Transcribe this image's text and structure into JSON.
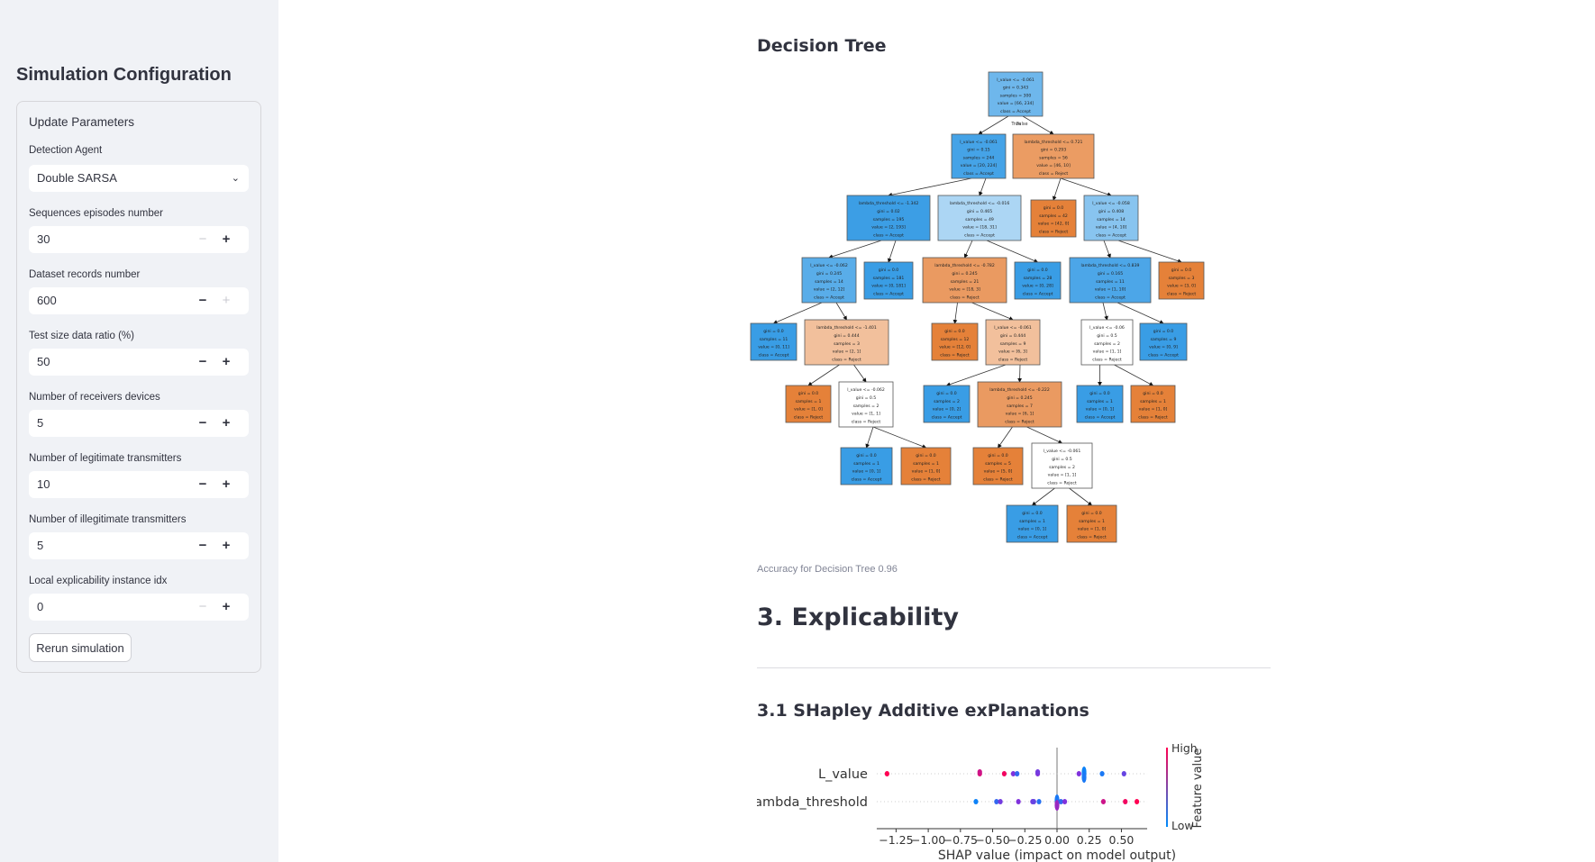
{
  "sidebar": {
    "title": "Simulation Configuration",
    "panel_title": "Update Parameters",
    "detection_agent": {
      "label": "Detection Agent",
      "value": "Double SARSA"
    },
    "fields": [
      {
        "label": "Sequences episodes number",
        "value": "30",
        "minus_enabled": false,
        "plus_enabled": true
      },
      {
        "label": "Dataset records number",
        "value": "600",
        "minus_enabled": true,
        "plus_enabled": false
      },
      {
        "label": "Test size data ratio (%)",
        "value": "50",
        "minus_enabled": true,
        "plus_enabled": true
      },
      {
        "label": "Number of receivers devices",
        "value": "5",
        "minus_enabled": true,
        "plus_enabled": true
      },
      {
        "label": "Number of legitimate transmitters",
        "value": "10",
        "minus_enabled": true,
        "plus_enabled": true
      },
      {
        "label": "Number of illegitimate transmitters",
        "value": "5",
        "minus_enabled": true,
        "plus_enabled": true
      },
      {
        "label": "Local explicability instance idx",
        "value": "0",
        "minus_enabled": false,
        "plus_enabled": true
      }
    ],
    "minus_symbol": "−",
    "plus_symbol": "+",
    "rerun_label": "Rerun simulation"
  },
  "main": {
    "tree_heading": "Decision Tree",
    "accuracy_caption": "Accuracy for Decision Tree 0.96",
    "section_heading": "3. Explicability",
    "shap_heading": "3.1 SHapley Additive exPlanations"
  },
  "tree": {
    "edge_labels": {
      "true": "True",
      "false": "False"
    },
    "colors": {
      "accept": "#399de5",
      "reject": "#e58139"
    },
    "nodes": {
      "root": [
        "l_value <= -0.061",
        "gini = 0.343",
        "samples = 300",
        "value = [66, 234]",
        "class = Accept"
      ],
      "n1": [
        "l_value <= -0.061",
        "gini = 0.15",
        "samples = 244",
        "value = [20, 224]",
        "class = Accept"
      ],
      "n2": [
        "lambda_threshold <= 0.721",
        "gini = 0.293",
        "samples = 56",
        "value = [46, 10]",
        "class = Reject"
      ],
      "A": [
        "lambda_threshold <= -1.342",
        "gini = 0.02",
        "samples = 195",
        "value = [2, 193]",
        "class = Accept"
      ],
      "B": [
        "lambda_threshold <= -0.016",
        "gini = 0.465",
        "samples = 49",
        "value = [18, 31]",
        "class = Accept"
      ],
      "C": [
        "gini = 0.0",
        "samples = 42",
        "value = [42, 0]",
        "class = Reject"
      ],
      "D": [
        "l_value <= -0.058",
        "gini = 0.408",
        "samples = 14",
        "value = [4, 10]",
        "class = Accept"
      ],
      "a": [
        "l_value <= -0.062",
        "gini = 0.245",
        "samples = 14",
        "value = [2, 12]",
        "class = Accept"
      ],
      "b": [
        "gini = 0.0",
        "samples = 181",
        "value = [0, 181]",
        "class = Accept"
      ],
      "c": [
        "lambda_threshold <= -0.782",
        "gini = 0.245",
        "samples = 21",
        "value = [18, 3]",
        "class = Reject"
      ],
      "d": [
        "gini = 0.0",
        "samples = 28",
        "value = [0, 28]",
        "class = Accept"
      ],
      "e": [
        "lambda_threshold <= 0.839",
        "gini = 0.165",
        "samples = 11",
        "value = [1, 10]",
        "class = Accept"
      ],
      "f": [
        "gini = 0.0",
        "samples = 3",
        "value = [3, 0]",
        "class = Reject"
      ],
      "g": [
        "gini = 0.0",
        "samples = 11",
        "value = [0, 11]",
        "class = Accept"
      ],
      "h": [
        "lambda_threshold <= -1.401",
        "gini = 0.444",
        "samples = 3",
        "value = [2, 1]",
        "class = Reject"
      ],
      "i": [
        "gini = 0.0",
        "samples = 12",
        "value = [12, 0]",
        "class = Reject"
      ],
      "j": [
        "l_value <= -0.061",
        "gini = 0.444",
        "samples = 9",
        "value = [6, 3]",
        "class = Reject"
      ],
      "k": [
        "l_value <= -0.06",
        "gini = 0.5",
        "samples = 2",
        "value = [1, 1]",
        "class = Reject"
      ],
      "l": [
        "gini = 0.0",
        "samples = 9",
        "value = [0, 9]",
        "class = Accept"
      ],
      "m": [
        "gini = 0.0",
        "samples = 1",
        "value = [1, 0]",
        "class = Reject"
      ],
      "n": [
        "l_value <= -0.062",
        "gini = 0.5",
        "samples = 2",
        "value = [1, 1]",
        "class = Reject"
      ],
      "o": [
        "gini = 0.0",
        "samples = 2",
        "value = [0, 2]",
        "class = Accept"
      ],
      "p": [
        "lambda_threshold <= -0.222",
        "gini = 0.245",
        "samples = 7",
        "value = [6, 1]",
        "class = Reject"
      ],
      "q": [
        "gini = 0.0",
        "samples = 1",
        "value = [0, 1]",
        "class = Accept"
      ],
      "r": [
        "gini = 0.0",
        "samples = 1",
        "value = [1, 0]",
        "class = Reject"
      ],
      "s": [
        "gini = 0.0",
        "samples = 1",
        "value = [0, 1]",
        "class = Accept"
      ],
      "t": [
        "gini = 0.0",
        "samples = 1",
        "value = [1, 0]",
        "class = Reject"
      ],
      "u": [
        "gini = 0.0",
        "samples = 5",
        "value = [5, 0]",
        "class = Reject"
      ],
      "v": [
        "l_value <= -0.061",
        "gini = 0.5",
        "samples = 2",
        "value = [1, 1]",
        "class = Reject"
      ],
      "w": [
        "gini = 0.0",
        "samples = 1",
        "value = [0, 1]",
        "class = Accept"
      ],
      "x": [
        "gini = 0.0",
        "samples = 1",
        "value = [1, 0]",
        "class = Reject"
      ]
    }
  },
  "chart_data": {
    "type": "scatter",
    "subtype": "shap-beeswarm",
    "xlabel": "SHAP value (impact on model output)",
    "xticks": [
      -1.25,
      -1.0,
      -0.75,
      -0.5,
      -0.25,
      0.0,
      0.25,
      0.5
    ],
    "xtick_labels": [
      "−1.25",
      "−1.00",
      "−0.75",
      "−0.50",
      "−0.25",
      "0.00",
      "0.25",
      "0.50"
    ],
    "xlim": [
      -1.4,
      0.7
    ],
    "features": [
      "L_value",
      "lambda_threshold"
    ],
    "colorbar": {
      "label": "Feature value",
      "high": "High",
      "low": "Low",
      "high_color": "#ff0052",
      "low_color": "#008bfb"
    },
    "points": {
      "L_value": [
        [
          -1.32,
          1
        ],
        [
          -0.6,
          0.85
        ],
        [
          -0.6,
          0.8
        ],
        [
          -0.41,
          0.95
        ],
        [
          -0.34,
          0.5
        ],
        [
          -0.31,
          0.2
        ],
        [
          -0.15,
          0.5
        ],
        [
          -0.15,
          0.45
        ],
        [
          0.17,
          0.5
        ],
        [
          0.21,
          0
        ],
        [
          0.21,
          0.05
        ],
        [
          0.21,
          0.1
        ],
        [
          0.35,
          0.1
        ],
        [
          0.52,
          0.4
        ]
      ],
      "lambda_threshold": [
        [
          -0.63,
          0.05
        ],
        [
          -0.47,
          0.2
        ],
        [
          -0.44,
          0.45
        ],
        [
          -0.3,
          0.5
        ],
        [
          -0.19,
          0.45
        ],
        [
          -0.18,
          0.4
        ],
        [
          -0.14,
          0.15
        ],
        [
          0.0,
          0.9
        ],
        [
          0.0,
          0.1
        ],
        [
          0.0,
          0.6
        ],
        [
          0.03,
          0.2
        ],
        [
          0.06,
          0.5
        ],
        [
          0.36,
          0.8
        ],
        [
          0.53,
          0.95
        ],
        [
          0.62,
          1
        ]
      ]
    }
  }
}
